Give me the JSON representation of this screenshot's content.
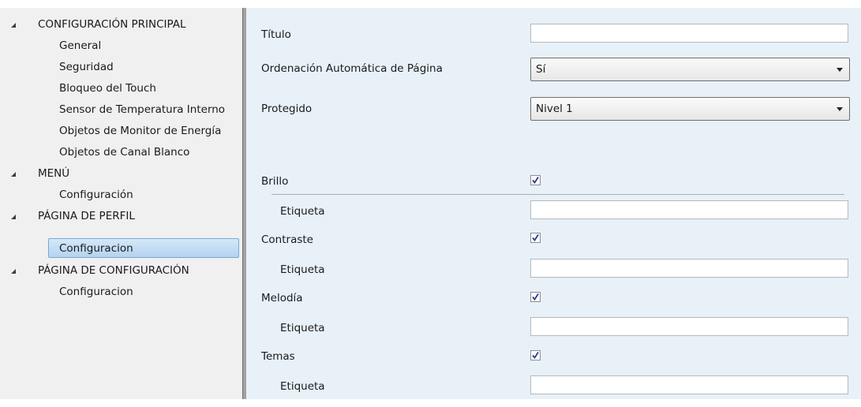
{
  "sidebar": {
    "sections": [
      {
        "label": "CONFIGURACIÓN PRINCIPAL",
        "children": [
          "General",
          "Seguridad",
          "Bloqueo del Touch",
          "Sensor de Temperatura Interno",
          "Objetos de Monitor de Energía",
          "Objetos de Canal Blanco"
        ]
      },
      {
        "label": "MENÚ",
        "children": [
          "Configuración"
        ]
      },
      {
        "label": "PÁGINA DE PERFIL",
        "children": [
          "Configuracion"
        ]
      },
      {
        "label": "PÁGINA DE CONFIGURACIÓN",
        "children": [
          "Configuracion"
        ]
      }
    ],
    "selected": "PÁGINA DE PERFIL > Configuracion"
  },
  "main": {
    "titulo": {
      "label": "Título",
      "value": ""
    },
    "ordenacion": {
      "label": "Ordenación Automática de Página",
      "value": "Sí"
    },
    "protegido": {
      "label": "Protegido",
      "value": "Nivel 1"
    },
    "items": [
      {
        "label": "Brillo",
        "checked": true,
        "etiqueta_label": "Etiqueta",
        "etiqueta_value": ""
      },
      {
        "label": "Contraste",
        "checked": true,
        "etiqueta_label": "Etiqueta",
        "etiqueta_value": ""
      },
      {
        "label": "Melodía",
        "checked": true,
        "etiqueta_label": "Etiqueta",
        "etiqueta_value": ""
      },
      {
        "label": "Temas",
        "checked": true,
        "etiqueta_label": "Etiqueta",
        "etiqueta_value": ""
      }
    ]
  },
  "colors": {
    "panel_bg": "#e8f1f8",
    "sidebar_bg": "#f0f0f0",
    "selection": "#b4d3f0",
    "check": "#2a3a8c"
  }
}
